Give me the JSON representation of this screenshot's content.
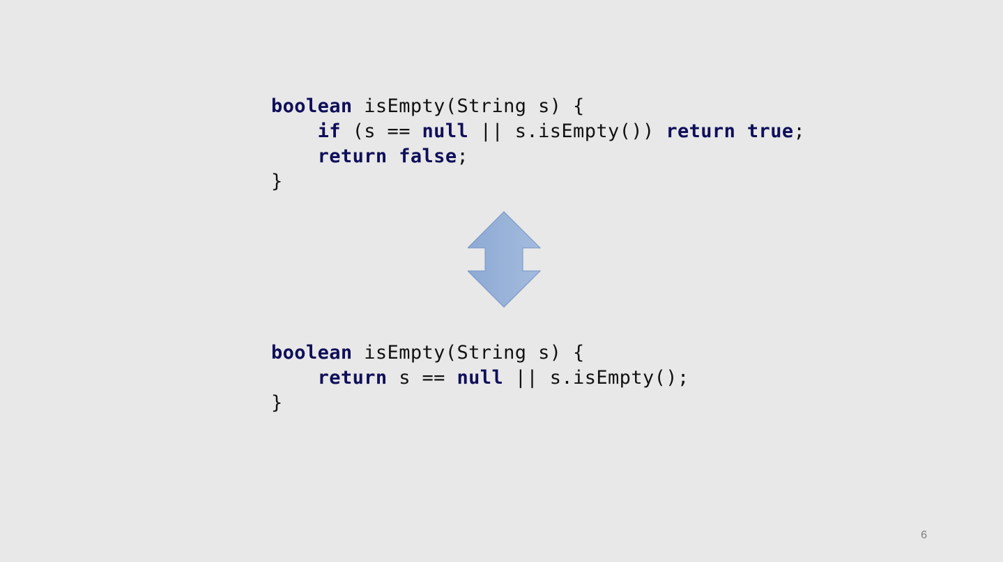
{
  "slide": {
    "page_number": "6",
    "arrow_icon": "up-down-arrow-icon",
    "colors": {
      "background": "#e8e8e8",
      "keyword": "#0f0f5a",
      "text": "#111111",
      "arrow_fill": "#94afd6",
      "arrow_stroke": "#6f8fbe"
    }
  },
  "code_before": {
    "line1": {
      "kw1": "boolean",
      "rest": " isEmpty(String s) {"
    },
    "line2": {
      "indent": "    ",
      "kw1": "if",
      "t1": " (s == ",
      "kw2": "null",
      "t2": " || s.isEmpty()) ",
      "kw3": "return",
      "t3": " ",
      "kw4": "true",
      "t4": ";"
    },
    "line3": {
      "indent": "    ",
      "kw1": "return",
      "t1": " ",
      "kw2": "false",
      "t2": ";"
    },
    "line4": {
      "text": "}"
    }
  },
  "code_after": {
    "line1": {
      "kw1": "boolean",
      "rest": " isEmpty(String s) {"
    },
    "line2": {
      "indent": "    ",
      "kw1": "return",
      "t1": " s == ",
      "kw2": "null",
      "t2": " || s.isEmpty();"
    },
    "line3": {
      "text": "}"
    }
  }
}
